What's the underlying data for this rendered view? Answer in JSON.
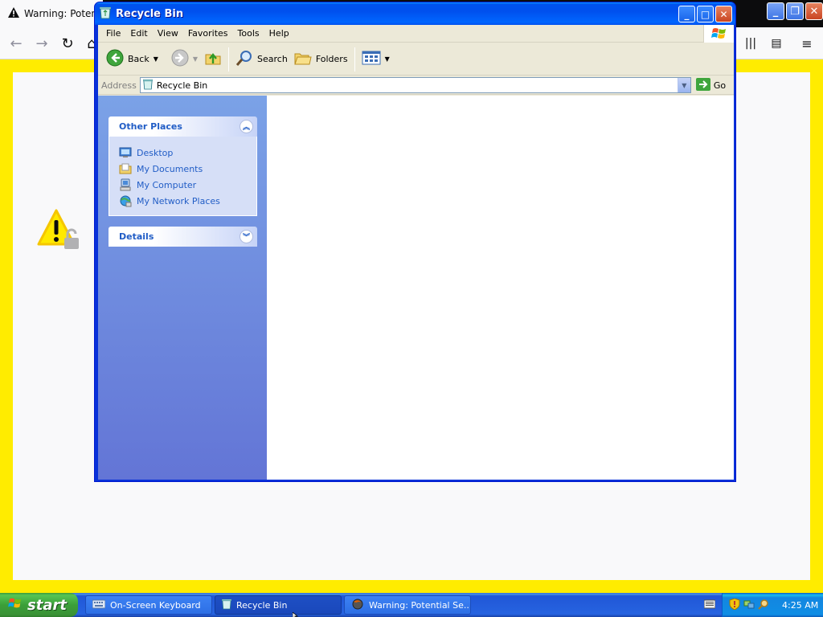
{
  "browser": {
    "tab_title": "Warning: Potential Security Risk Ahead",
    "tab_title_visible": "Warning: Potentia"
  },
  "explorer": {
    "title": "Recycle Bin",
    "menu": [
      "File",
      "Edit",
      "View",
      "Favorites",
      "Tools",
      "Help"
    ],
    "toolbar": {
      "back_label": "Back",
      "search_label": "Search",
      "folders_label": "Folders"
    },
    "address": {
      "label": "Address",
      "value": "Recycle Bin",
      "go_label": "Go"
    },
    "other_places": {
      "title": "Other Places",
      "links": [
        "Desktop",
        "My Documents",
        "My Computer",
        "My Network Places"
      ]
    },
    "details": {
      "title": "Details"
    }
  },
  "taskbar": {
    "start_label": "start",
    "tasks": [
      "On-Screen Keyboard",
      "Recycle Bin",
      "Warning: Potential Se..."
    ],
    "clock": "4:25 AM"
  },
  "colors": {
    "warning_yellow": "#ffec00",
    "xp_blue": "#0053ee",
    "taskpane_link": "#215dc6"
  }
}
